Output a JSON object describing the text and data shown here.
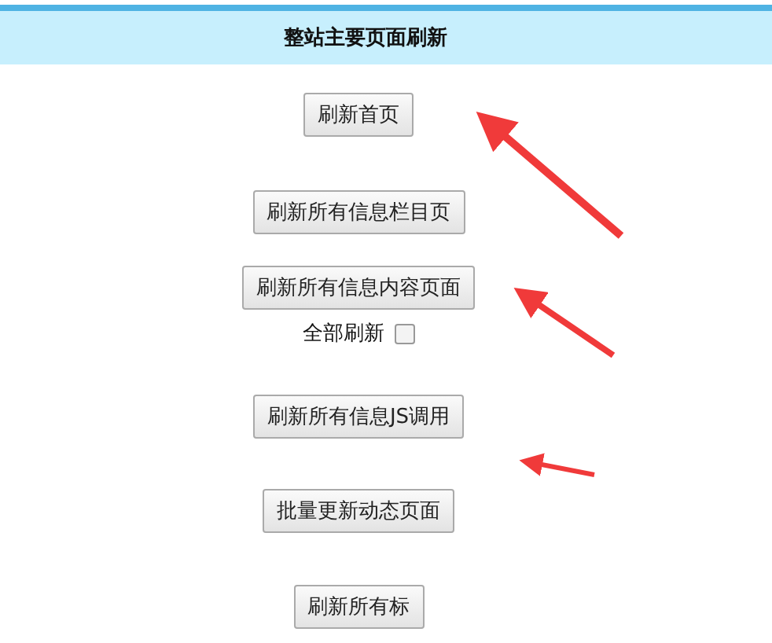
{
  "header": {
    "title": "整站主要页面刷新"
  },
  "items": [
    {
      "kind": "button",
      "label": "刷新首页"
    },
    {
      "kind": "button",
      "label": "刷新所有信息栏目页"
    },
    {
      "kind": "button",
      "label": "刷新所有信息内容页面",
      "option": {
        "label": "全部刷新",
        "checked": false
      }
    },
    {
      "kind": "button",
      "label": "刷新所有信息JS调用"
    },
    {
      "kind": "button",
      "label": "批量更新动态页面"
    },
    {
      "kind": "button",
      "label": "刷新所有标"
    }
  ]
}
